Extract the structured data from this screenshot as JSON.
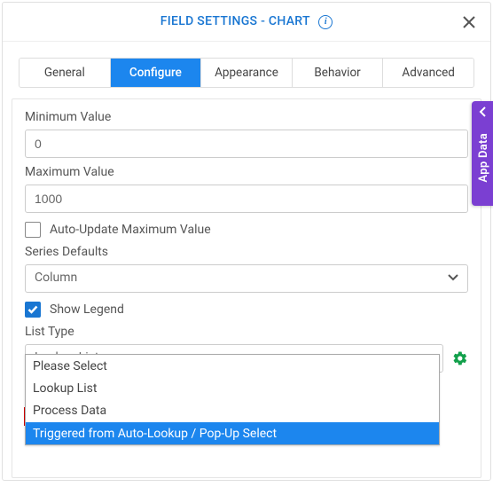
{
  "header": {
    "title": "FIELD SETTINGS - CHART"
  },
  "tabs": {
    "items": [
      {
        "label": "General"
      },
      {
        "label": "Configure"
      },
      {
        "label": "Appearance"
      },
      {
        "label": "Behavior"
      },
      {
        "label": "Advanced"
      }
    ],
    "activeIndex": 1
  },
  "form": {
    "minValue": {
      "label": "Minimum Value",
      "value": "0"
    },
    "maxValue": {
      "label": "Maximum Value",
      "value": "1000"
    },
    "autoUpdate": {
      "label": "Auto-Update Maximum Value",
      "checked": false
    },
    "seriesDefaults": {
      "label": "Series Defaults",
      "value": "Column"
    },
    "showLegend": {
      "label": "Show Legend",
      "checked": true
    },
    "listType": {
      "label": "List Type",
      "value": "Lookup List",
      "options": [
        "Please Select",
        "Lookup List",
        "Process Data",
        "Triggered from Auto-Lookup / Pop-Up Select"
      ],
      "highlightedIndex": 3
    }
  },
  "sideTab": {
    "label": "App Data"
  }
}
